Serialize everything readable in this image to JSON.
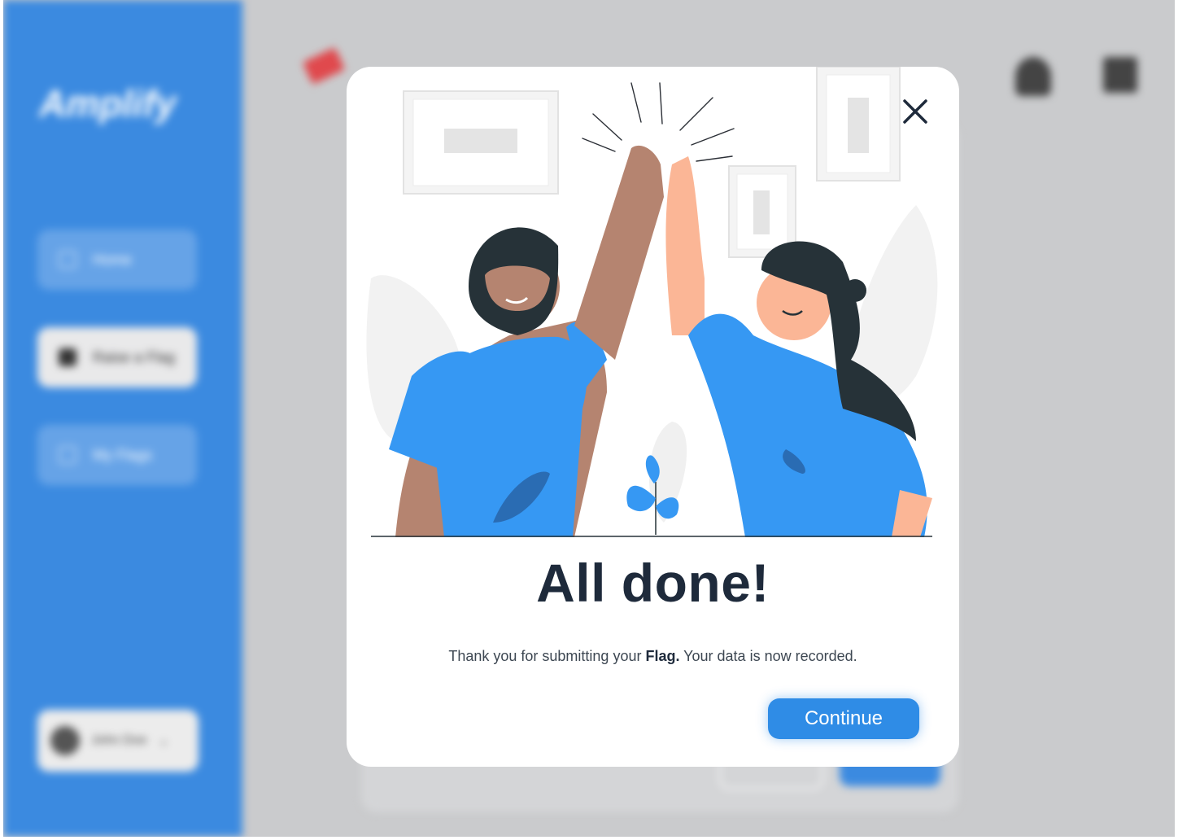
{
  "app": {
    "logo_text": "Amplify",
    "nav_items": [
      {
        "label": "Home",
        "icon": "home-icon"
      },
      {
        "label": "Raise a Flag",
        "icon": "flag-icon"
      },
      {
        "label": "My Flags",
        "icon": "list-icon"
      }
    ],
    "user": {
      "name": "John Doe",
      "icon": "chevron-down-icon"
    }
  },
  "modal": {
    "close_icon": "close-icon",
    "title": "All done!",
    "message_before": "Thank you for submitting your ",
    "message_bold": "Flag.",
    "message_after": " Your data is now recorded.",
    "continue_label": "Continue"
  },
  "colors": {
    "sidebar": "#3b8ae0",
    "accent": "#2f8ce6",
    "title": "#1e2a3b",
    "shirt": "#3698f3"
  }
}
